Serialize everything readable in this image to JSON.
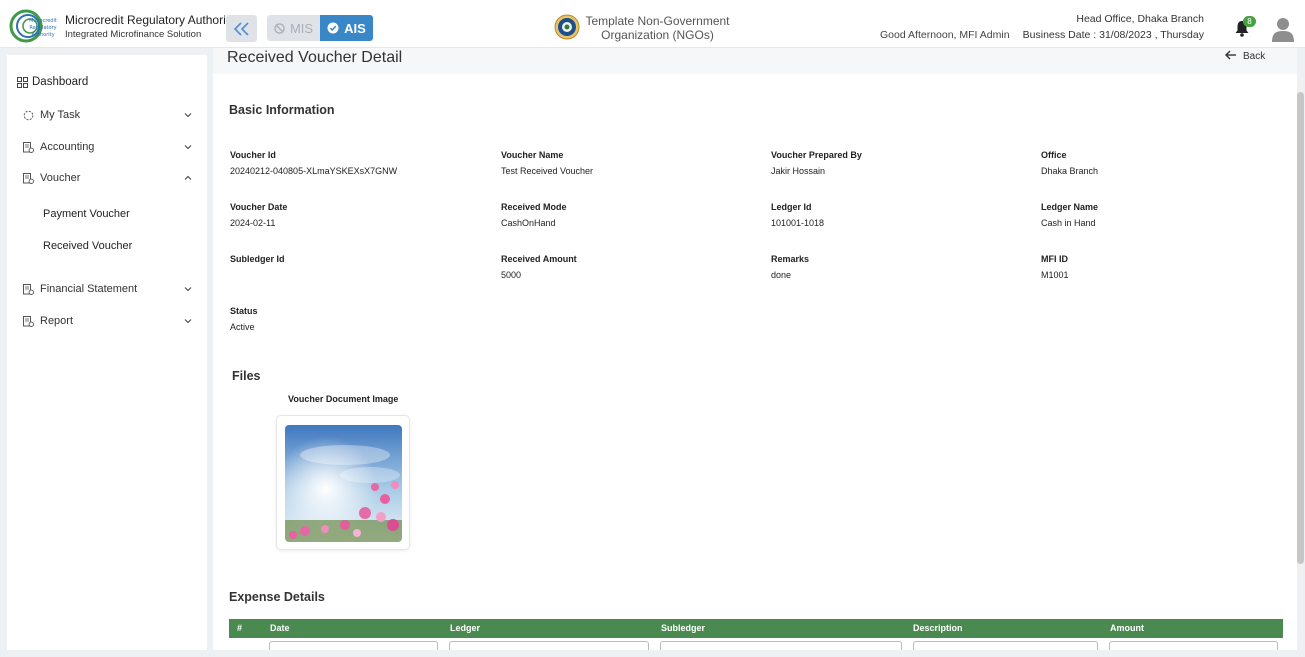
{
  "header": {
    "brand_title": "Microcredit Regulatory Authority",
    "brand_subtitle": "Integrated Microfinance Solution",
    "logo_text": [
      "Microcredit",
      "Regulatory",
      "Authority"
    ],
    "mis_label": "MIS",
    "ais_label": "AIS",
    "org_name_line1": "Template Non-Government",
    "org_name_line2": "Organization (NGOs)",
    "greeting": "Good Afternoon, MFI Admin",
    "office": "Head Office, Dhaka Branch",
    "business_date": "Business Date : 31/08/2023 , Thursday",
    "notification_count": "8",
    "accent_color": "#3a87c8",
    "badge_color": "#47a140"
  },
  "sidebar": {
    "dashboard": "Dashboard",
    "my_task": "My Task",
    "accounting": "Accounting",
    "voucher": "Voucher",
    "payment_voucher": "Payment Voucher",
    "received_voucher": "Received Voucher",
    "financial_statement": "Financial Statement",
    "report": "Report"
  },
  "main": {
    "page_title": "Received Voucher Detail",
    "back_label": "Back",
    "basic_info_title": "Basic Information",
    "fields": [
      {
        "label": "Voucher Id",
        "value": "20240212-040805-XLmaYSKEXsX7GNW"
      },
      {
        "label": "Voucher Name",
        "value": "Test Received Voucher"
      },
      {
        "label": "Voucher Prepared By",
        "value": "Jakir Hossain"
      },
      {
        "label": "Office",
        "value": "Dhaka Branch"
      },
      {
        "label": "Voucher Date",
        "value": "2024-02-11"
      },
      {
        "label": "Received Mode",
        "value": "CashOnHand"
      },
      {
        "label": "Ledger Id",
        "value": "101001-1018"
      },
      {
        "label": "Ledger Name",
        "value": "Cash in Hand"
      },
      {
        "label": "Subledger Id",
        "value": ""
      },
      {
        "label": "Received Amount",
        "value": "5000"
      },
      {
        "label": "Remarks",
        "value": "done"
      },
      {
        "label": "MFI ID",
        "value": "M1001"
      },
      {
        "label": "Status",
        "value": "Active"
      }
    ],
    "files_title": "Files",
    "document_label": "Voucher Document Image",
    "expense_title": "Expense Details",
    "table_headers": [
      "#",
      "Date",
      "Ledger",
      "Subledger",
      "Description",
      "Amount"
    ],
    "table_header_color": "#4a8a50"
  }
}
